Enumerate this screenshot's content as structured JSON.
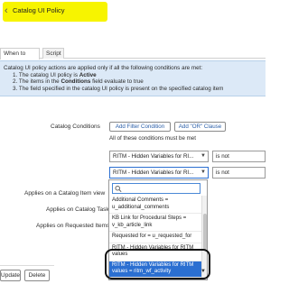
{
  "header": {
    "title": "Catalog UI Policy",
    "highlight_color": "#f7f400"
  },
  "tabs": [
    {
      "label": "When to Apply",
      "active": true
    },
    {
      "label": "Script",
      "active": false
    }
  ],
  "info": {
    "intro": "Catalog UI policy actions are applied only if all the following conditions are met:",
    "line1": "1. The catalog UI policy is ",
    "line1_bold": "Active",
    "line2_pre": "2. The items in the ",
    "line2_bold": "Conditions",
    "line2_post": " field evaluate to true",
    "line3": "3. The field specified in the catalog UI policy is present on the specified catalog item"
  },
  "conditions": {
    "label": "Catalog Conditions",
    "add_filter": "Add Filter Condition",
    "add_or": "Add \"OR\" Clause",
    "note": "All of these conditions must be met",
    "row1_field": "RITM - Hidden Variables for RI...",
    "row1_op": "is not",
    "row2_field": "RITM - Hidden Variables for RI...",
    "row2_op": "is not"
  },
  "labels": {
    "applies_item_view": "Applies on a Catalog Item view",
    "applies_tasks": "Applies on Catalog Tasks",
    "applies_requested": "Applies on Requested Items"
  },
  "dropdown": {
    "search_value": "",
    "items": [
      "Additional Comments = u_additional_comments",
      "KB Link for Procedural Steps = v_kb_article_link",
      "Requested for = u_requested_for",
      "RITM - Hidden Variables for RITM values",
      "RITM - Hidden Variables for RITM values = ritm_wf_activity"
    ],
    "selected_index": 4
  },
  "buttons": {
    "update": "Update",
    "delete": "Delete"
  }
}
